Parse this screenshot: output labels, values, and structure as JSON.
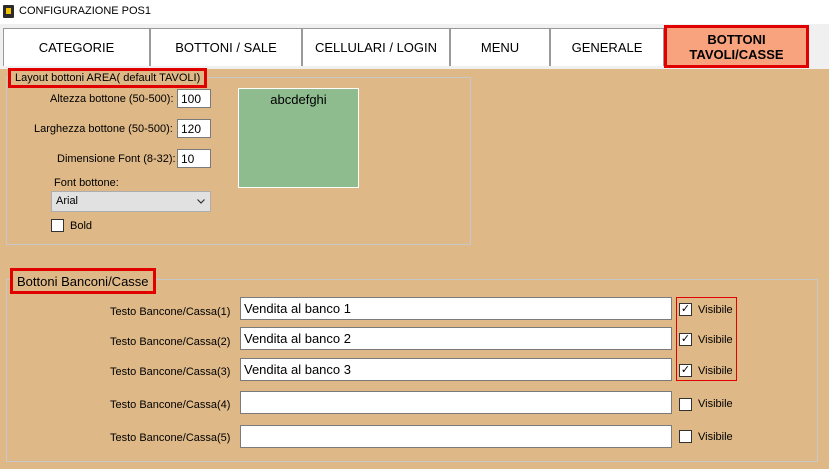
{
  "window": {
    "title": "CONFIGURAZIONE POS1"
  },
  "tabs": [
    {
      "label": "CATEGORIE"
    },
    {
      "label": "BOTTONI / SALE"
    },
    {
      "label": "CELLULARI / LOGIN"
    },
    {
      "label": "MENU"
    },
    {
      "label": "GENERALE"
    },
    {
      "label": "BOTTONI\nTAVOLI/CASSE"
    }
  ],
  "layout_group": {
    "title": "Layout bottoni AREA( default TAVOLI)",
    "height_label": "Altezza bottone (50-500):",
    "height_value": "100",
    "width_label": "Larghezza bottone (50-500):",
    "width_value": "120",
    "font_size_label": "Dimensione Font (8-32):",
    "font_size_value": "10",
    "font_label": "Font bottone:",
    "font_value": "Arial",
    "bold_label": "Bold",
    "preview_text": "abcdefghi"
  },
  "banconi_group": {
    "title": "Bottoni Banconi/Casse",
    "visible_label": "Visibile",
    "rows": [
      {
        "label": "Testo Bancone/Cassa(1)",
        "value": "Vendita al banco 1",
        "visible": true
      },
      {
        "label": "Testo Bancone/Cassa(2)",
        "value": "Vendita al banco 2",
        "visible": true
      },
      {
        "label": "Testo Bancone/Cassa(3)",
        "value": "Vendita al banco 3",
        "visible": true
      },
      {
        "label": "Testo Bancone/Cassa(4)",
        "value": "",
        "visible": false
      },
      {
        "label": "Testo Bancone/Cassa(5)",
        "value": "",
        "visible": false
      }
    ]
  },
  "colors": {
    "panel": "#deb887",
    "active_tab": "#f9a27e",
    "highlight": "#e00000",
    "preview": "#8fbc8f"
  }
}
